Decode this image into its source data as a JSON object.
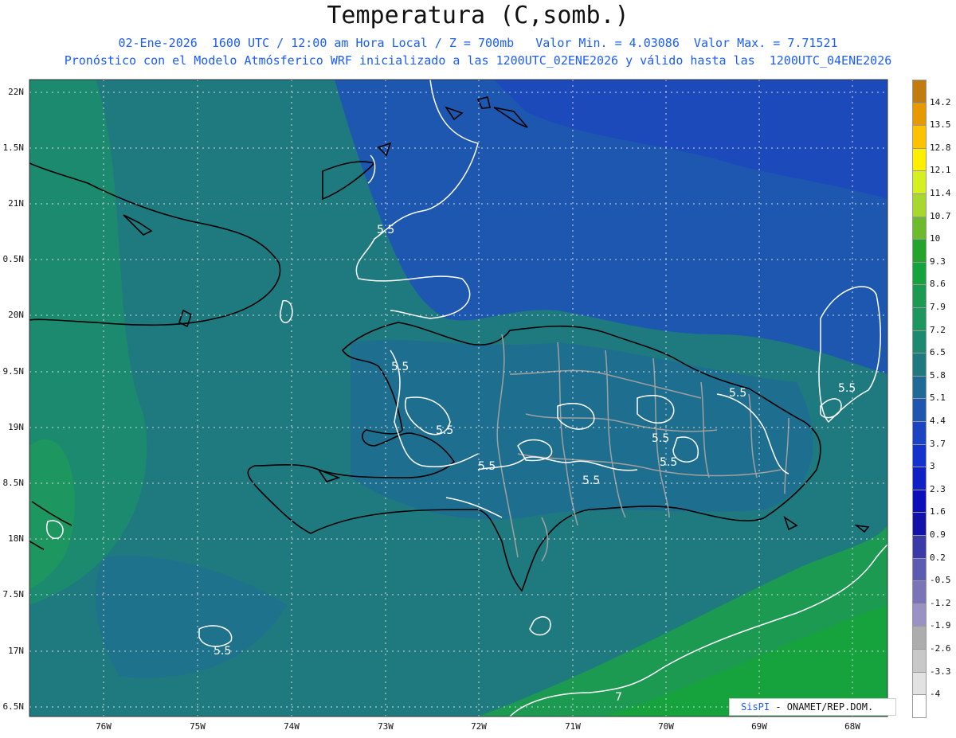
{
  "title": "Temperatura (C,somb.)",
  "subtitle1": "02-Ene-2026  1600 UTC / 12:00 am Hora Local / Z = 700mb   Valor Min. = 4.03086  Valor Max. = 7.71521",
  "subtitle2": "Pronóstico con el Modelo Atmósferico WRF inicializado a las 1200UTC_02ENE2026 y válido hasta las  1200UTC_04ENE2026",
  "lat_labels": [
    "22N",
    "1.5N",
    "21N",
    "0.5N",
    "20N",
    "9.5N",
    "19N",
    "8.5N",
    "18N",
    "7.5N",
    "17N",
    "6.5N"
  ],
  "lon_labels": [
    "76W",
    "75W",
    "74W",
    "73W",
    "72W",
    "71W",
    "70W",
    "69W",
    "68W"
  ],
  "colorbar": {
    "labels": [
      "14.2",
      "13.5",
      "12.8",
      "12.1",
      "11.4",
      "10.7",
      "10",
      "9.3",
      "8.6",
      "7.9",
      "7.2",
      "6.5",
      "5.8",
      "5.1",
      "4.4",
      "3.7",
      "3",
      "2.3",
      "1.6",
      "0.9",
      "0.2",
      "-0.5",
      "-1.2",
      "-1.9",
      "-2.6",
      "-3.3",
      "-4"
    ],
    "colors": [
      "#c27c0e",
      "#e69a00",
      "#ffc200",
      "#ffee00",
      "#d4f020",
      "#a8d830",
      "#6cbb2a",
      "#22a52a",
      "#16a23c",
      "#1c9a52",
      "#1e9660",
      "#1c8a6e",
      "#1f7a80",
      "#1f6a96",
      "#1d57b0",
      "#1c44c0",
      "#1432cc",
      "#1020c4",
      "#0c10b8",
      "#1212a8",
      "#3a3aa8",
      "#5c5cb0",
      "#7c74b8",
      "#9a92c4",
      "#adadad",
      "#c8c8c8",
      "#e2e2e2",
      "#ffffff"
    ]
  },
  "contour_labels": [
    "5.5",
    "5.5",
    "5.5",
    "5.5",
    "5.5",
    "5.5",
    "5.5",
    "5.5",
    "5.5",
    "5.5",
    "7"
  ],
  "credit": {
    "brand": "SisPI",
    "text": "- ONAMET/REP.DOM."
  }
}
